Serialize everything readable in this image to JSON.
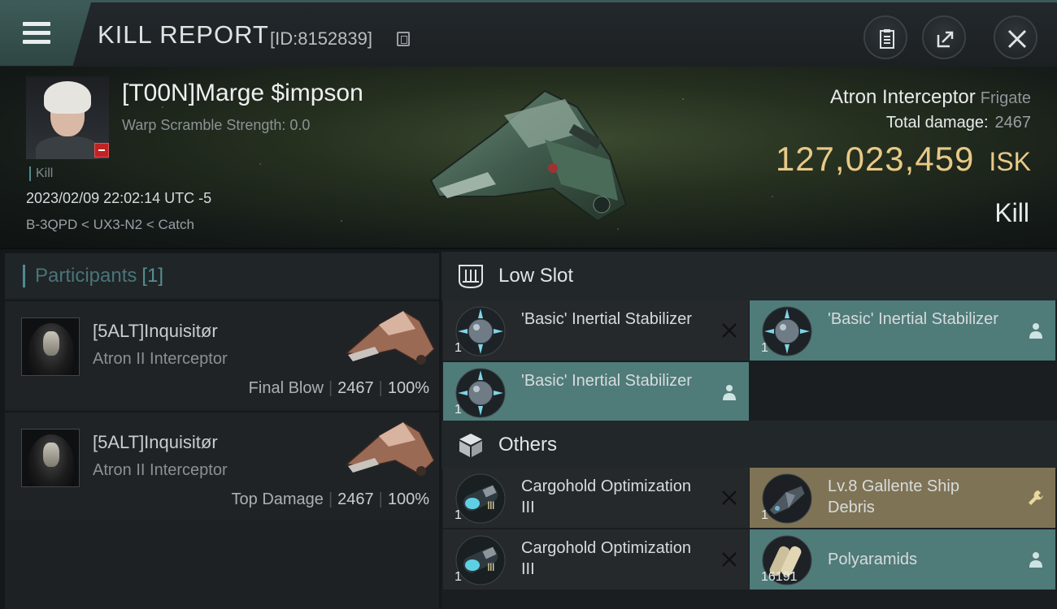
{
  "header": {
    "title": "KILL REPORT",
    "report_id": "[ID:8152839]"
  },
  "victim": {
    "name": "[T00N]Marge $impson",
    "warp_scramble": "Warp Scramble Strength: 0.0",
    "kill_tag": "Kill",
    "datetime": "2023/02/09 22:02:14 UTC -5",
    "location": "B-3QPD < UX3-N2 < Catch",
    "ship": "Atron Interceptor",
    "ship_class": "Frigate",
    "total_damage_label": "Total damage:",
    "total_damage": "2467",
    "isk_value": "127,023,459",
    "isk_unit": "ISK",
    "result": "Kill"
  },
  "participants": {
    "title": "Participants",
    "count": "[1]",
    "rows": [
      {
        "name": "[5ALT]Inquisitør",
        "ship": "Atron II Interceptor",
        "role": "Final Blow",
        "damage": "2467",
        "percent": "100%"
      },
      {
        "name": "[5ALT]Inquisitør",
        "ship": "Atron II Interceptor",
        "role": "Top Damage",
        "damage": "2467",
        "percent": "100%"
      }
    ]
  },
  "sections": {
    "low_slot": "Low Slot",
    "others": "Others"
  },
  "low_slot_items": [
    {
      "name": "'Basic' Inertial Stabilizer",
      "qty": "1",
      "status": "destroyed"
    },
    {
      "name": "'Basic' Inertial Stabilizer",
      "qty": "1",
      "status": "dropped"
    },
    {
      "name": "'Basic' Inertial Stabilizer",
      "qty": "1",
      "status": "dropped"
    }
  ],
  "other_items": [
    {
      "name": "Cargohold Optimization III",
      "qty": "1",
      "meta": "III",
      "status": "destroyed"
    },
    {
      "name": "Lv.8 Gallente Ship Debris",
      "qty": "1",
      "status": "loot"
    },
    {
      "name": "Cargohold Optimization III",
      "qty": "1",
      "meta": "III",
      "status": "destroyed"
    },
    {
      "name": "Polyaramids",
      "qty": "16191",
      "status": "dropped"
    }
  ],
  "colors": {
    "accent_teal": "#4f7b79",
    "isk_gold": "#e8c987",
    "loot_tan": "#7f7355",
    "self_destruct_red": "#c32222"
  },
  "icons": [
    "menu-icon",
    "copy-icon",
    "clipboard-icon",
    "share-icon",
    "close-icon",
    "low-slot-icon",
    "cube-icon",
    "destroyed-x-icon",
    "person-icon",
    "wrench-icon"
  ]
}
